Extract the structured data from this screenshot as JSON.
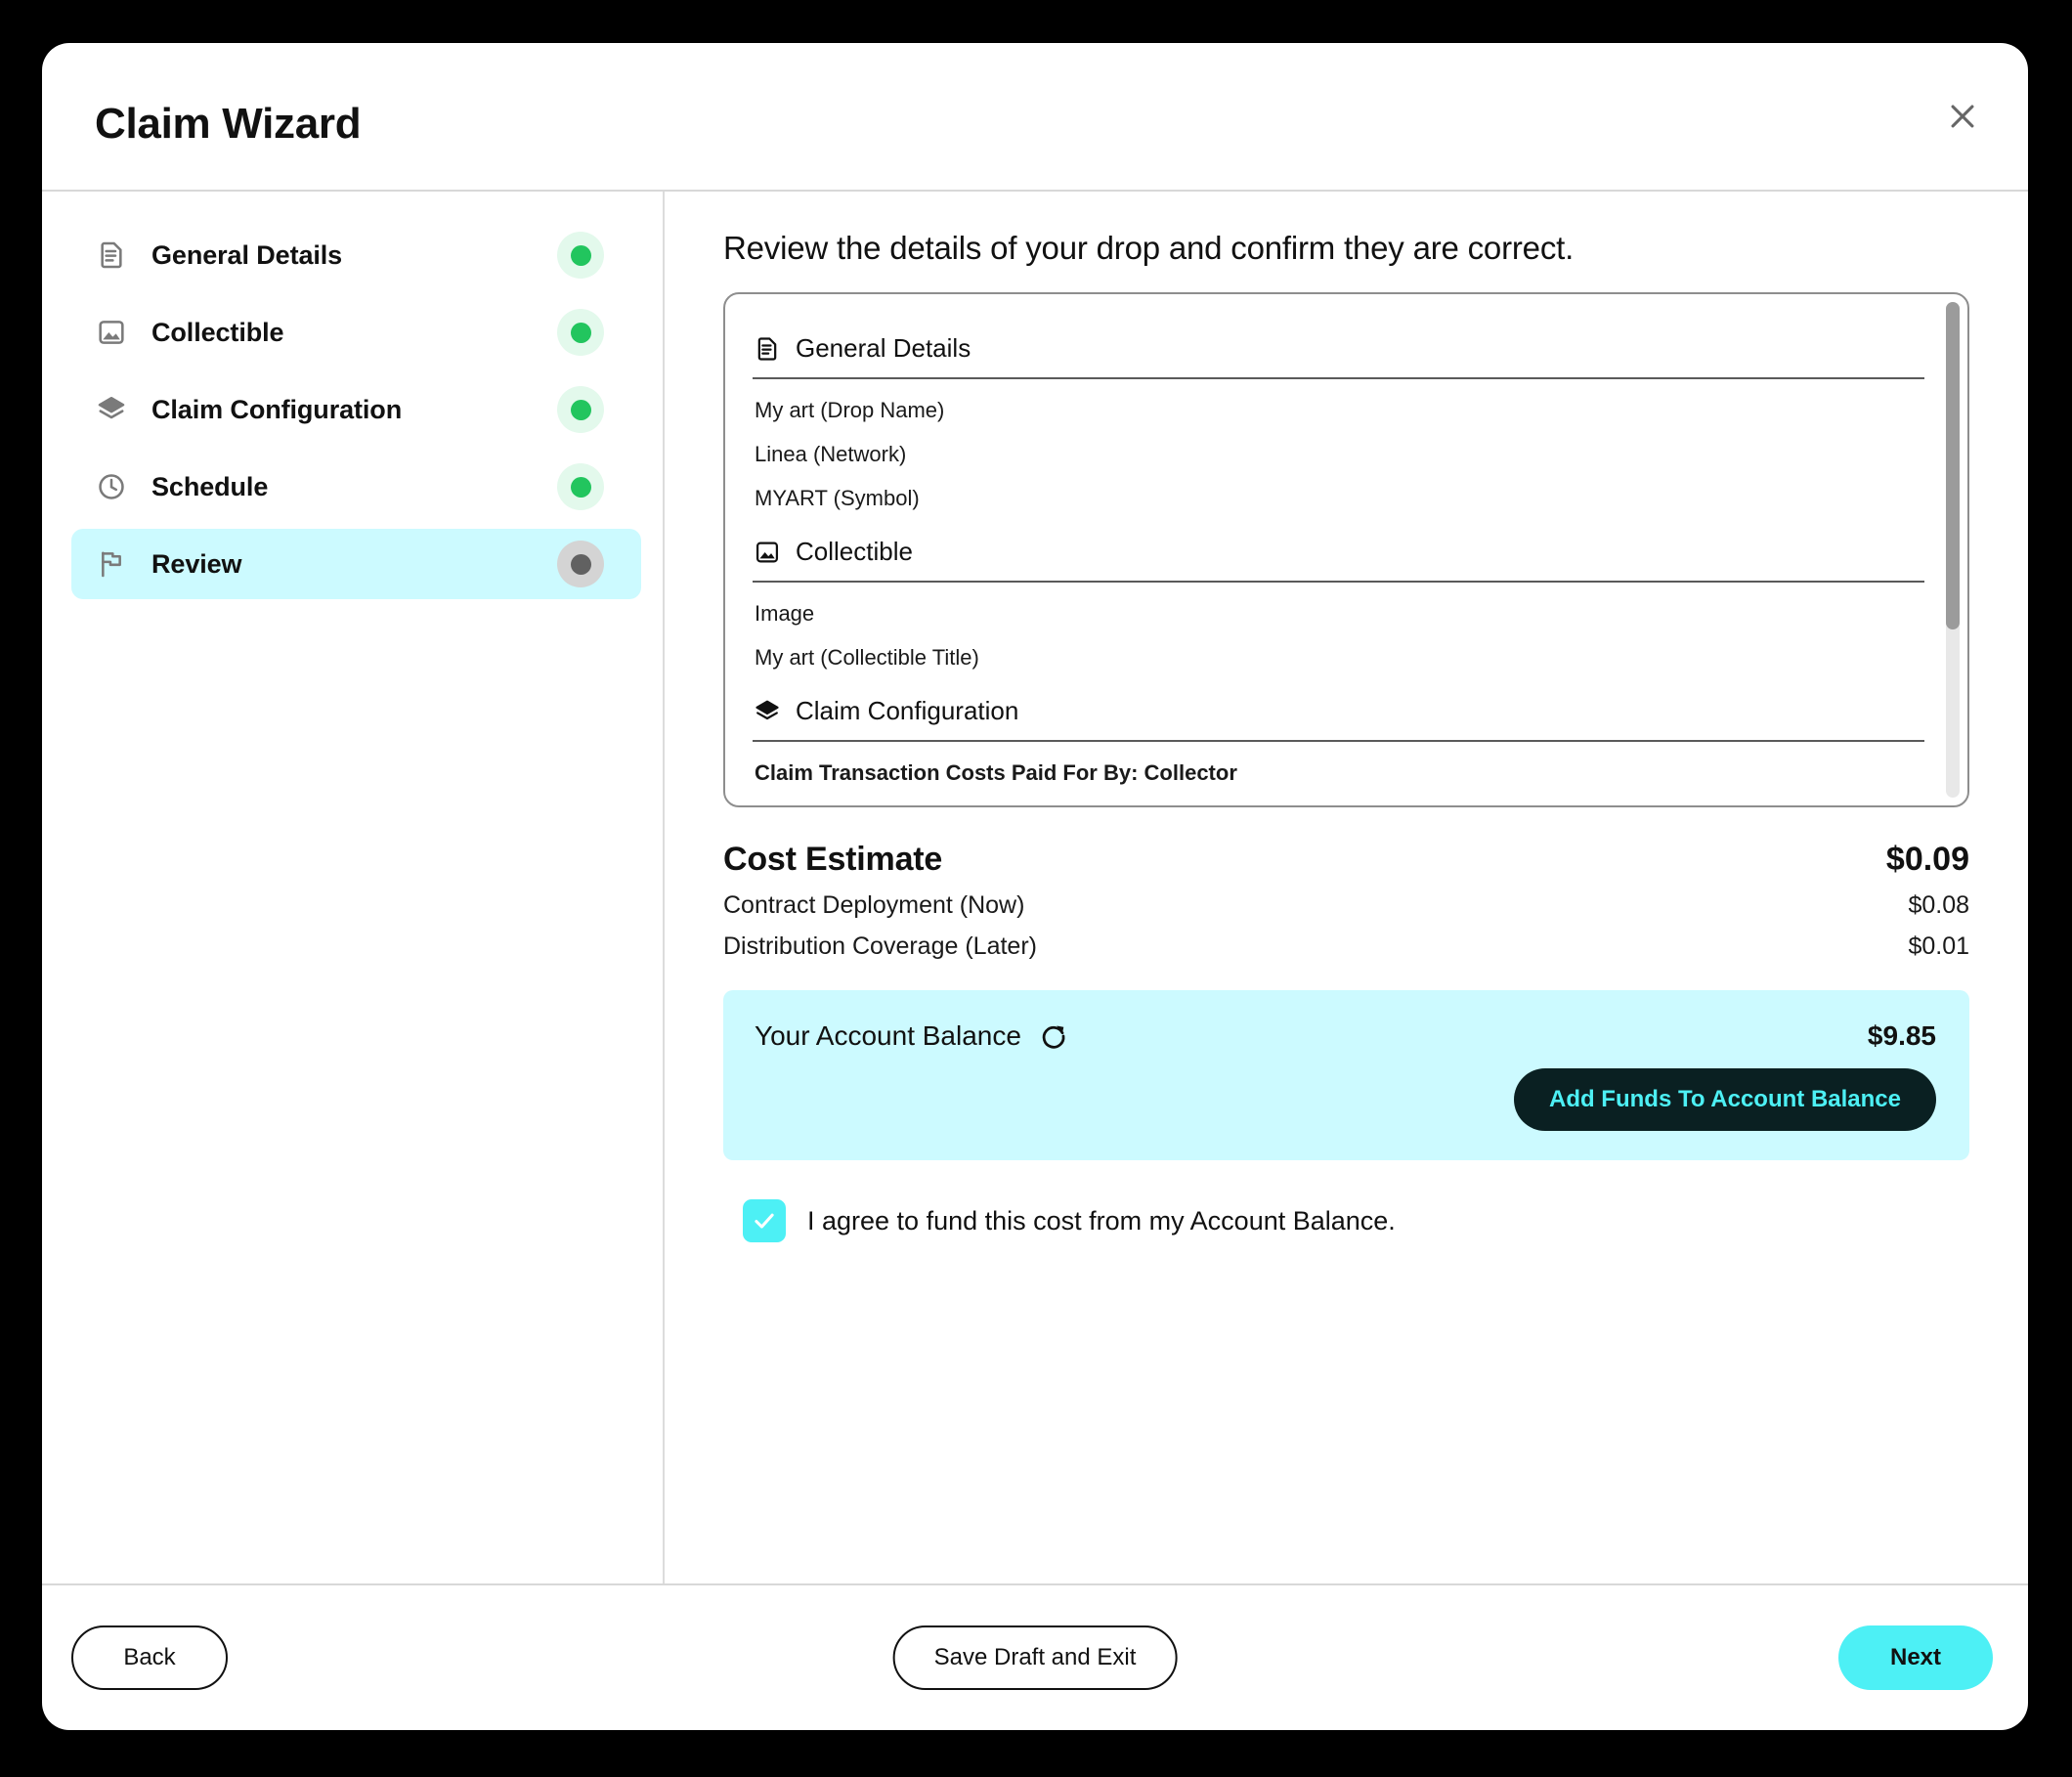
{
  "dialog": {
    "title": "Claim Wizard",
    "close_icon": "close-icon"
  },
  "sidebar": {
    "items": [
      {
        "label": "General Details",
        "icon": "document-icon",
        "status": "done",
        "active": false
      },
      {
        "label": "Collectible",
        "icon": "image-icon",
        "status": "done",
        "active": false
      },
      {
        "label": "Claim Configuration",
        "icon": "layers-icon",
        "status": "done",
        "active": false
      },
      {
        "label": "Schedule",
        "icon": "clock-icon",
        "status": "done",
        "active": false
      },
      {
        "label": "Review",
        "icon": "flag-icon",
        "status": "current",
        "active": true
      }
    ]
  },
  "main": {
    "heading": "Review the details of your drop and confirm they are correct.",
    "summary": {
      "sections": [
        {
          "icon": "document-icon",
          "title": "General Details",
          "lines": [
            "My art (Drop Name)",
            "Linea (Network)",
            "MYART (Symbol)"
          ]
        },
        {
          "icon": "image-icon",
          "title": "Collectible",
          "lines": [
            "Image",
            "My art (Collectible Title)"
          ]
        },
        {
          "icon": "layers-icon",
          "title": "Claim Configuration",
          "lines": [
            "Claim Transaction Costs Paid For By: Collector"
          ]
        }
      ]
    },
    "cost_estimate": {
      "title": "Cost Estimate",
      "total": "$0.09",
      "rows": [
        {
          "label": "Contract Deployment (Now)",
          "value": "$0.08"
        },
        {
          "label": "Distribution Coverage (Later)",
          "value": "$0.01"
        }
      ]
    },
    "balance": {
      "label": "Your Account Balance",
      "refresh_icon": "refresh-icon",
      "amount": "$9.85",
      "add_funds_label": "Add Funds To Account Balance"
    },
    "agreement": {
      "checked": true,
      "text": "I agree to fund this cost from my Account Balance."
    }
  },
  "footer": {
    "back_label": "Back",
    "save_label": "Save Draft and Exit",
    "next_label": "Next"
  },
  "colors": {
    "accent_cyan": "#4df0f5",
    "accent_cyan_light": "#ccfaff",
    "status_done": "#22c55e",
    "status_current": "#616161",
    "dark_button": "#0a2022"
  }
}
